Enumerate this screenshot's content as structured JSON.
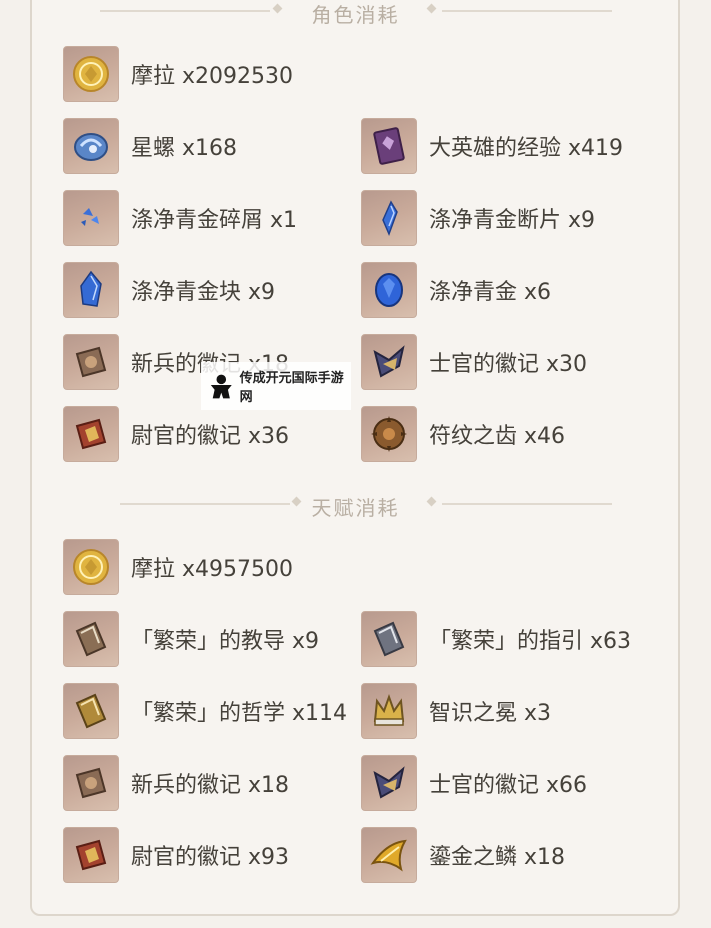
{
  "sections": [
    {
      "title": "角色消耗"
    },
    {
      "title": "天赋消耗"
    }
  ],
  "character_items": [
    {
      "label": "摩拉 x2092530",
      "icon": "mora-coin-icon"
    },
    {
      "label": "星螺 x168",
      "icon": "starconch-icon"
    },
    {
      "label": "大英雄的经验 x419",
      "icon": "heros-wit-book-icon"
    },
    {
      "label": "涤净青金碎屑 x1",
      "icon": "lazurite-sliver-icon"
    },
    {
      "label": "涤净青金断片 x9",
      "icon": "lazurite-fragment-icon"
    },
    {
      "label": "涤净青金块 x9",
      "icon": "lazurite-chunk-icon"
    },
    {
      "label": "涤净青金 x6",
      "icon": "lazurite-gemstone-icon"
    },
    {
      "label": "新兵的徽记 x18",
      "icon": "recruit-insignia-icon"
    },
    {
      "label": "士官的徽记 x30",
      "icon": "sergeant-insignia-icon"
    },
    {
      "label": "尉官的徽记 x36",
      "icon": "lieutenant-insignia-icon"
    },
    {
      "label": "符纹之齿 x46",
      "icon": "runic-fang-icon"
    }
  ],
  "talent_items": [
    {
      "label": "摩拉 x4957500",
      "icon": "mora-coin-icon"
    },
    {
      "label": "「繁荣」的教导 x9",
      "icon": "prosperity-teachings-icon"
    },
    {
      "label": "「繁荣」的指引 x63",
      "icon": "prosperity-guide-icon"
    },
    {
      "label": "「繁荣」的哲学 x114",
      "icon": "prosperity-philosophies-icon"
    },
    {
      "label": "智识之冕 x3",
      "icon": "crown-of-insight-icon"
    },
    {
      "label": "新兵的徽记 x18",
      "icon": "recruit-insignia-icon"
    },
    {
      "label": "士官的徽记 x66",
      "icon": "sergeant-insignia-icon"
    },
    {
      "label": "尉官的徽记 x93",
      "icon": "lieutenant-insignia-icon"
    },
    {
      "label": "鎏金之鳞 x18",
      "icon": "gilded-scale-icon"
    }
  ],
  "watermark": {
    "text": "传成开元国际手游网",
    "icon": "meeple-icon"
  }
}
